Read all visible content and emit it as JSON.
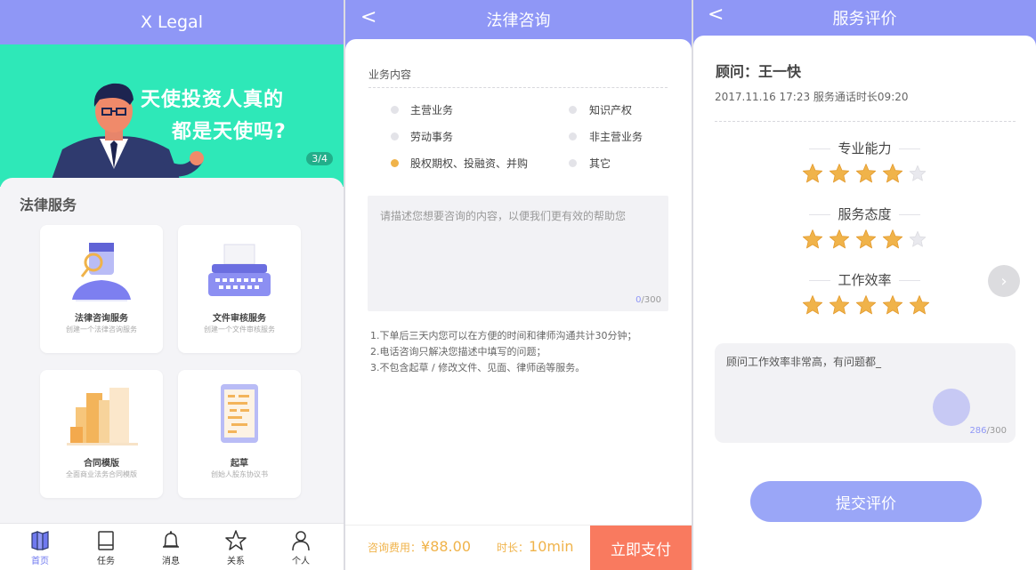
{
  "screen1": {
    "title": "X Legal",
    "banner": {
      "line1": "天使投资人真的",
      "line2": "都是天使吗?",
      "pager": "3/4"
    },
    "section_title": "法律服务",
    "cards": [
      {
        "title": "法律咨询服务",
        "subtitle": "创建一个法律咨询服务",
        "icon": "advisor-illustration"
      },
      {
        "title": "文件审核服务",
        "subtitle": "创建一个文件审核服务",
        "icon": "typewriter-illustration"
      },
      {
        "title": "合同模版",
        "subtitle": "全面商业法务合同模版",
        "icon": "buildings-illustration"
      },
      {
        "title": "起草",
        "subtitle": "创始人股东协议书",
        "icon": "tablet-document-illustration"
      }
    ],
    "tabs": [
      {
        "label": "首页",
        "icon": "home-icon",
        "active": true
      },
      {
        "label": "任务",
        "icon": "book-icon",
        "active": false
      },
      {
        "label": "消息",
        "icon": "bell-icon",
        "active": false
      },
      {
        "label": "关系",
        "icon": "star-icon",
        "active": false
      },
      {
        "label": "个人",
        "icon": "person-icon",
        "active": false
      }
    ]
  },
  "screen2": {
    "title": "法律咨询",
    "back": "<",
    "business_label": "业务内容",
    "options": [
      {
        "label": "主营业务",
        "selected": false
      },
      {
        "label": "知识产权",
        "selected": false
      },
      {
        "label": "劳动事务",
        "selected": false
      },
      {
        "label": "非主营业务",
        "selected": false
      },
      {
        "label": "股权期权、投融资、并购",
        "selected": true
      },
      {
        "label": "其它",
        "selected": false
      }
    ],
    "textarea": {
      "placeholder": "请描述您想要咨询的内容，以便我们更有效的帮助您",
      "count": "0",
      "max": "/300"
    },
    "notes": [
      "1.下单后三天内您可以在方便的时间和律师沟通共计30分钟；",
      "2.电话咨询只解决您描述中填写的问题；",
      "3.不包含起草 / 修改文件、见面、律师函等服务。"
    ],
    "fee_label": "咨询费用：",
    "fee_value": "¥88.00",
    "duration_label": "时长：",
    "duration_value": "10min",
    "pay_button": "立即支付"
  },
  "screen3": {
    "title": "服务评价",
    "back": "<",
    "advisor": "顾问：王一快",
    "meta": "2017.11.16  17:23  服务通话时长09:20",
    "ratings": [
      {
        "label": "专业能力",
        "score": 4,
        "max": 5
      },
      {
        "label": "服务态度",
        "score": 4,
        "max": 5
      },
      {
        "label": "工作效率",
        "score": 5,
        "max": 5
      }
    ],
    "next": "›",
    "comment": {
      "text": "顾问工作效率非常高，有问题都_",
      "count": "286",
      "max": "/300"
    },
    "submit": "提交评价"
  },
  "colors": {
    "primary": "#8f97f6",
    "banner": "#2ee8b8",
    "accent": "#f0b34a",
    "pay": "#f97a5f",
    "star": "#f0b34a"
  }
}
